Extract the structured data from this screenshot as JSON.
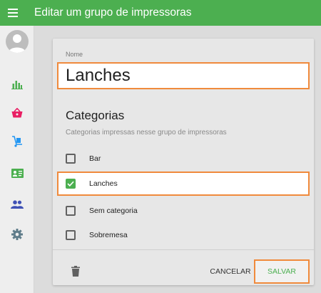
{
  "appbar": {
    "title": "Editar um grupo de impressoras",
    "menu_icon": "menu-icon"
  },
  "sidebar": {
    "avatar_icon": "user-avatar-icon",
    "items": [
      {
        "icon": "bar-chart-icon",
        "color": "#4caf50"
      },
      {
        "icon": "shopping-basket-icon",
        "color": "#e91e63"
      },
      {
        "icon": "hand-truck-icon",
        "color": "#2196f3"
      },
      {
        "icon": "id-card-icon",
        "color": "#4caf50"
      },
      {
        "icon": "people-icon",
        "color": "#3f51b5"
      },
      {
        "icon": "gear-icon",
        "color": "#607d8b"
      }
    ]
  },
  "form": {
    "name_label": "Nome",
    "name_value": "Lanches",
    "section_title": "Categorias",
    "section_subtitle": "Categorias impressas nesse grupo de impressoras",
    "categories": [
      {
        "label": "Bar",
        "checked": false
      },
      {
        "label": "Lanches",
        "checked": true
      },
      {
        "label": "Sem categoria",
        "checked": false
      },
      {
        "label": "Sobremesa",
        "checked": false
      }
    ]
  },
  "actions": {
    "delete_icon": "trash-icon",
    "cancel_label": "CANCELAR",
    "save_label": "SALVAR"
  },
  "colors": {
    "appbar": "#4caf50",
    "highlight": "#f08a3c",
    "checked": "#4caf50",
    "save_text": "#4caf50"
  }
}
